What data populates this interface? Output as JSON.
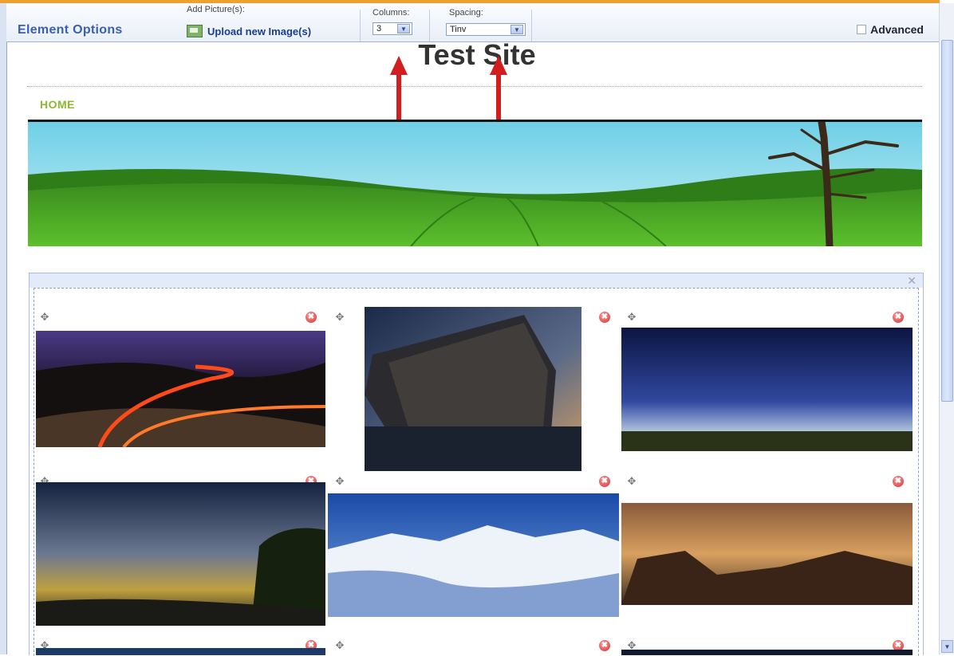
{
  "toolbar": {
    "title": "Element Options",
    "add_pictures_label": "Add Picture(s):",
    "upload_label": "Upload new Image(s)",
    "columns_label": "Columns:",
    "columns_value": "3",
    "spacing_label": "Spacing:",
    "spacing_value": "Tinv",
    "advanced_label": "Advanced"
  },
  "site": {
    "title": "Test Site",
    "nav_home": "HOME"
  },
  "gallery": {
    "close_glyph": "✕",
    "photos": [
      {
        "name": "night-road-light-trails"
      },
      {
        "name": "skyscraper-sunset"
      },
      {
        "name": "night-sky-horizon"
      },
      {
        "name": "coastal-night-clouds"
      },
      {
        "name": "snowy-mountains"
      },
      {
        "name": "rocky-coast-sunset"
      }
    ]
  },
  "icons": {
    "move": "✥",
    "delete": "✖"
  },
  "colors": {
    "accent_orange": "#f0a030",
    "title_blue": "#3a5fb0",
    "home_green": "#8cb933",
    "arrow_red": "#d21e1e"
  }
}
